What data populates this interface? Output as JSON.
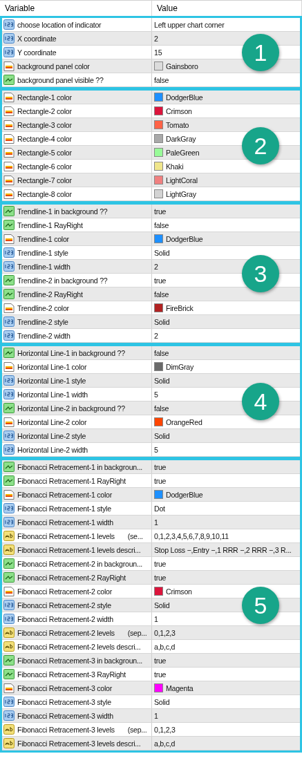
{
  "columns": [
    "Variable",
    "Value"
  ],
  "groups": [
    {
      "badge": "1",
      "rows": [
        {
          "kind": "int",
          "name": "choose location of indicator",
          "value": "Left upper chart corner"
        },
        {
          "kind": "int",
          "name": "X coordinate",
          "value": "2"
        },
        {
          "kind": "int",
          "name": "Y coordinate",
          "value": "15"
        },
        {
          "kind": "color",
          "name": "background panel color",
          "value": "Gainsboro",
          "color": "#dcdcdc"
        },
        {
          "kind": "bool",
          "name": "background panel visible ??",
          "value": "false"
        }
      ]
    },
    {
      "badge": "2",
      "rows": [
        {
          "kind": "color",
          "name": "Rectangle-1 color",
          "value": "DodgerBlue",
          "color": "#1e90ff"
        },
        {
          "kind": "color",
          "name": "Rectangle-2 color",
          "value": "Crimson",
          "color": "#dc143c"
        },
        {
          "kind": "color",
          "name": "Rectangle-3 color",
          "value": "Tomato",
          "color": "#ff6347"
        },
        {
          "kind": "color",
          "name": "Rectangle-4 color",
          "value": "DarkGray",
          "color": "#a9a9a9"
        },
        {
          "kind": "color",
          "name": "Rectangle-5 color",
          "value": "PaleGreen",
          "color": "#98fb98"
        },
        {
          "kind": "color",
          "name": "Rectangle-6 color",
          "value": "Khaki",
          "color": "#f0e68c"
        },
        {
          "kind": "color",
          "name": "Rectangle-7 color",
          "value": "LightCoral",
          "color": "#f08080"
        },
        {
          "kind": "color",
          "name": "Rectangle-8 color",
          "value": "LightGray",
          "color": "#d3d3d3"
        }
      ]
    },
    {
      "badge": "3",
      "rows": [
        {
          "kind": "bool",
          "name": "Trendline-1 in background ??",
          "value": "true"
        },
        {
          "kind": "bool",
          "name": "Trendline-1 RayRight",
          "value": "false"
        },
        {
          "kind": "color",
          "name": "Trendline-1 color",
          "value": "DodgerBlue",
          "color": "#1e90ff"
        },
        {
          "kind": "int",
          "name": "Trendline-1 style",
          "value": "Solid"
        },
        {
          "kind": "int",
          "name": "Trendline-1 width",
          "value": "2"
        },
        {
          "kind": "bool",
          "name": "Trendline-2 in background ??",
          "value": "true"
        },
        {
          "kind": "bool",
          "name": "Trendline-2 RayRight",
          "value": "false"
        },
        {
          "kind": "color",
          "name": "Trendline-2 color",
          "value": "FireBrick",
          "color": "#b22222"
        },
        {
          "kind": "int",
          "name": "Trendline-2 style",
          "value": "Solid"
        },
        {
          "kind": "int",
          "name": "Trendline-2 width",
          "value": "2"
        }
      ]
    },
    {
      "badge": "4",
      "rows": [
        {
          "kind": "bool",
          "name": "Horizontal Line-1 in background ??",
          "value": "false"
        },
        {
          "kind": "color",
          "name": "Horizontal Line-1 color",
          "value": "DimGray",
          "color": "#696969"
        },
        {
          "kind": "int",
          "name": "Horizontal Line-1 style",
          "value": "Solid"
        },
        {
          "kind": "int",
          "name": "Horizontal Line-1 width",
          "value": "5"
        },
        {
          "kind": "bool",
          "name": "Horizontal Line-2 in background ??",
          "value": "false"
        },
        {
          "kind": "color",
          "name": "Horizontal Line-2 color",
          "value": "OrangeRed",
          "color": "#ff4500"
        },
        {
          "kind": "int",
          "name": "Horizontal Line-2 style",
          "value": "Solid"
        },
        {
          "kind": "int",
          "name": "Horizontal Line-2 width",
          "value": "5"
        }
      ]
    },
    {
      "badge": "5",
      "rows": [
        {
          "kind": "bool",
          "name": "Fibonacci Retracement-1 in backgroun...",
          "value": "true"
        },
        {
          "kind": "bool",
          "name": "Fibonacci Retracement-1 RayRight",
          "value": "true"
        },
        {
          "kind": "color",
          "name": "Fibonacci Retracement-1 color",
          "value": "DodgerBlue",
          "color": "#1e90ff"
        },
        {
          "kind": "int",
          "name": "Fibonacci Retracement-1 style",
          "value": "Dot"
        },
        {
          "kind": "int",
          "name": "Fibonacci Retracement-1 width",
          "value": "1"
        },
        {
          "kind": "string",
          "name": "Fibonacci Retracement-1 levels       (se...",
          "value": "0,1,2,3,4,5,6,7,8,9,10,11"
        },
        {
          "kind": "string",
          "name": "Fibonacci Retracement-1 levels descri...",
          "value": "Stop Loss −,Entry −,1 RRR −,2 RRR −,3 R..."
        },
        {
          "kind": "bool",
          "name": "Fibonacci Retracement-2 in backgroun...",
          "value": "true"
        },
        {
          "kind": "bool",
          "name": "Fibonacci Retracement-2 RayRight",
          "value": "true"
        },
        {
          "kind": "color",
          "name": "Fibonacci Retracement-2 color",
          "value": "Crimson",
          "color": "#dc143c"
        },
        {
          "kind": "int",
          "name": "Fibonacci Retracement-2 style",
          "value": "Solid"
        },
        {
          "kind": "int",
          "name": "Fibonacci Retracement-2 width",
          "value": "1"
        },
        {
          "kind": "string",
          "name": "Fibonacci Retracement-2 levels       (sep...",
          "value": "0,1,2,3"
        },
        {
          "kind": "string",
          "name": "Fibonacci Retracement-2 levels descri...",
          "value": "a,b,c,d"
        },
        {
          "kind": "bool",
          "name": "Fibonacci Retracement-3 in backgroun...",
          "value": "true"
        },
        {
          "kind": "bool",
          "name": "Fibonacci Retracement-3 RayRight",
          "value": "true"
        },
        {
          "kind": "color",
          "name": "Fibonacci Retracement-3 color",
          "value": "Magenta",
          "color": "#ff00ff"
        },
        {
          "kind": "int",
          "name": "Fibonacci Retracement-3 style",
          "value": "Solid"
        },
        {
          "kind": "int",
          "name": "Fibonacci Retracement-3 width",
          "value": "1"
        },
        {
          "kind": "string",
          "name": "Fibonacci Retracement-3 levels       (sep...",
          "value": "0,1,2,3"
        },
        {
          "kind": "string",
          "name": "Fibonacci Retracement-3 levels descri...",
          "value": "a,b,c,d"
        }
      ]
    }
  ]
}
